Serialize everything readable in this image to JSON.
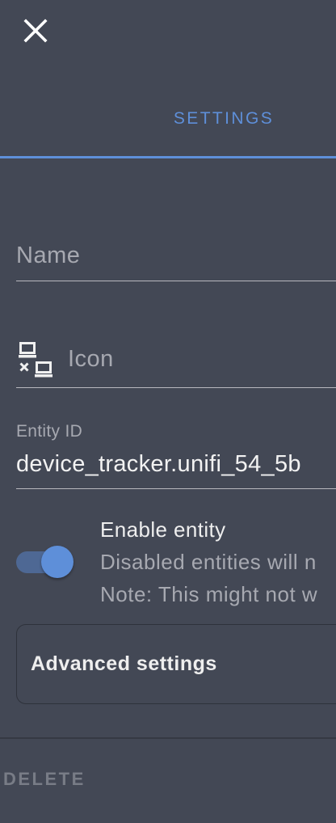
{
  "header": {
    "close_icon": "close-icon"
  },
  "tabs": [
    {
      "label": "SETTINGS",
      "active": true
    }
  ],
  "form": {
    "name": {
      "placeholder": "Name",
      "value": ""
    },
    "icon": {
      "placeholder": "Icon",
      "value": "",
      "icon": "lan-disconnect-icon"
    },
    "entity_id": {
      "label": "Entity ID",
      "value": "device_tracker.unifi_54_5b"
    }
  },
  "enable": {
    "title": "Enable entity",
    "enabled": true,
    "desc_line1": "Disabled entities will n",
    "desc_line2": "Note: This might not w"
  },
  "advanced": {
    "label": "Advanced settings"
  },
  "footer": {
    "delete_label": "DELETE"
  },
  "colors": {
    "background": "#434855",
    "accent": "#5e8fd9",
    "text_primary": "#eeeeee",
    "text_secondary": "#a7a9b1"
  }
}
